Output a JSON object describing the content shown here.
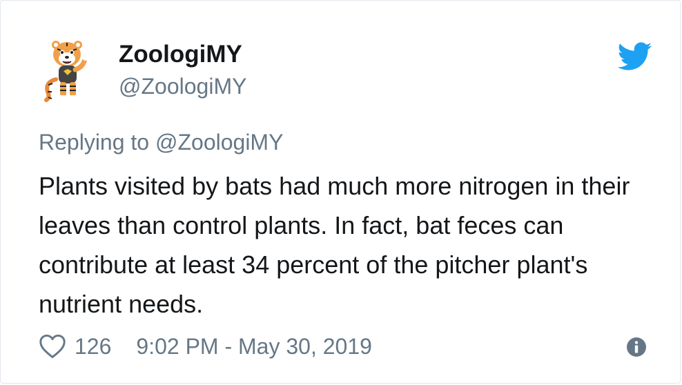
{
  "tweet": {
    "author": {
      "display_name": "ZoologiMY",
      "handle": "@ZoologiMY",
      "avatar": "tiger-mascot-avatar"
    },
    "replying_to": "Replying to @ZoologiMY",
    "text": "Plants visited by bats had much more nitrogen in their leaves than control plants. In fact, bat feces can contribute at least 34 percent of the pitcher plant's nutrient needs.",
    "likes": "126",
    "timestamp": "9:02 PM - May 30, 2019",
    "icons": {
      "brand": "twitter-bird-icon",
      "like": "heart-icon",
      "info": "info-icon"
    },
    "colors": {
      "brand": "#1da1f2",
      "text": "#14171a",
      "muted": "#657786",
      "border": "#e1e8ed"
    }
  }
}
